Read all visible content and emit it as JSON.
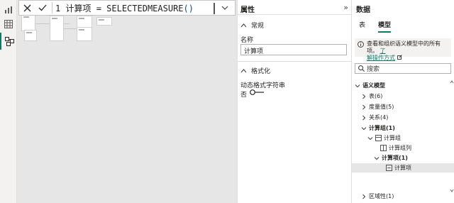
{
  "formula": {
    "line_number": "1",
    "text_before": "计算项 = SELECTEDMEASURE",
    "parens": "()"
  },
  "properties": {
    "title": "属性",
    "general_section": "常规",
    "name_label": "名称",
    "name_value": "计算项",
    "formatting_section": "格式化",
    "dynamic_format_label": "动态格式字符串",
    "toggle_state": "否"
  },
  "data_pane": {
    "title": "数据",
    "tabs": [
      "表",
      "模型"
    ],
    "info_text": "查看和组织语义模型中的所有项。",
    "info_link_1": "了",
    "info_link_2": "解操作方式",
    "search_placeholder": "搜索",
    "tree": [
      {
        "label": "语义模型",
        "bold": true
      },
      {
        "label": "表",
        "count": "(6)"
      },
      {
        "label": "度量值",
        "count": "(5)"
      },
      {
        "label": "关系",
        "count": "(4)"
      },
      {
        "label": "计算组",
        "count": "(1)",
        "bold": true
      },
      {
        "label": "计算组"
      },
      {
        "label": "计算组列"
      },
      {
        "label": "计算项",
        "count": "(1)",
        "bold": true
      },
      {
        "label": "计算项"
      },
      {
        "label": "区域性",
        "count": "(1)"
      }
    ]
  },
  "colors": {
    "accent": "#117865",
    "canvas": "#e6e6e6",
    "rail": "#f3f2f1"
  },
  "icons": [
    "report-view-icon",
    "table-view-icon",
    "model-view-icon",
    "close-icon",
    "check-icon",
    "chevron-down-icon",
    "info-icon",
    "search-icon",
    "external-link-icon",
    "double-chevron-right-icon",
    "calculation-group-icon",
    "column-icon",
    "calculation-item-icon"
  ]
}
